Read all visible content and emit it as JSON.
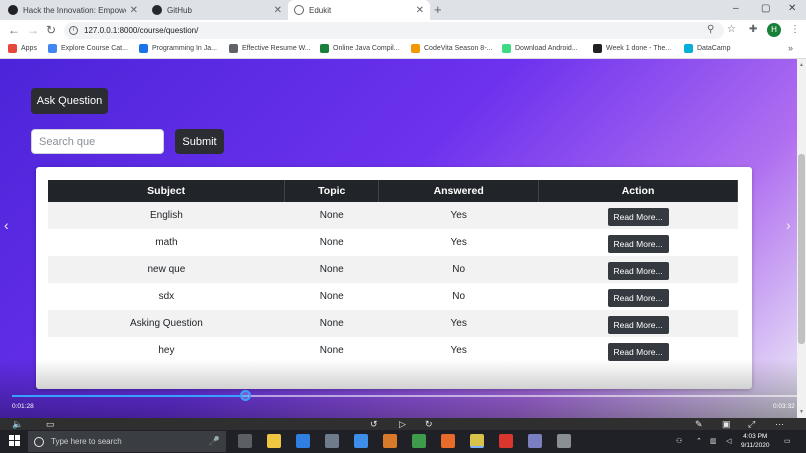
{
  "browser": {
    "tabs": [
      {
        "title": "Hack the Innovation: Empowerin",
        "active": false
      },
      {
        "title": "GitHub",
        "active": false
      },
      {
        "title": "Edukit",
        "active": true
      }
    ],
    "new_tab": "+",
    "window_controls": {
      "minimize": "–",
      "maximize": "▢",
      "close": "✕"
    },
    "url": "127.0.0.1:8000/course/question/",
    "bookmarks": [
      {
        "label": "Apps",
        "color": "#e8453c"
      },
      {
        "label": "Explore Course Cat...",
        "color": "#4285f4"
      },
      {
        "label": "Programming In Ja...",
        "color": "#1a73e8"
      },
      {
        "label": "Effective Resume W...",
        "color": "#5f6368"
      },
      {
        "label": "Online Java Compil...",
        "color": "#188038"
      },
      {
        "label": "CodeVita Season 8-...",
        "color": "#f29900"
      },
      {
        "label": "Download Android...",
        "color": "#3ddc84"
      },
      {
        "label": "Week 1 done - The...",
        "color": "#202124"
      },
      {
        "label": "DataCamp",
        "color": "#03b0d7"
      }
    ],
    "profile_initial": "H"
  },
  "page": {
    "ask_button": "Ask Question",
    "search_placeholder": "Search que",
    "submit_button": "Submit",
    "table": {
      "headers": [
        "Subject",
        "Topic",
        "Answered",
        "Action"
      ],
      "rows": [
        {
          "subject": "English",
          "topic": "None",
          "answered": "Yes",
          "action": "Read More..."
        },
        {
          "subject": "math",
          "topic": "None",
          "answered": "Yes",
          "action": "Read More..."
        },
        {
          "subject": "new que",
          "topic": "None",
          "answered": "No",
          "action": "Read More..."
        },
        {
          "subject": "sdx",
          "topic": "None",
          "answered": "No",
          "action": "Read More..."
        },
        {
          "subject": "Asking Question",
          "topic": "None",
          "answered": "Yes",
          "action": "Read More..."
        },
        {
          "subject": "hey",
          "topic": "None",
          "answered": "Yes",
          "action": "Read More..."
        }
      ]
    }
  },
  "video": {
    "elapsed": "0:01:28",
    "duration": "0:03:32",
    "progress_fraction": 0.3
  },
  "taskbar": {
    "search_placeholder": "Type here to search",
    "time": "4:03 PM",
    "date": "9/11/2020",
    "apps": [
      {
        "name": "task-view",
        "color": "#5c5f66"
      },
      {
        "name": "file-explorer",
        "color": "#f0c541"
      },
      {
        "name": "edge",
        "color": "#2f7fe0"
      },
      {
        "name": "store",
        "color": "#6e7b8a"
      },
      {
        "name": "mail",
        "color": "#3c8ee8"
      },
      {
        "name": "app-orange",
        "color": "#d97a2b"
      },
      {
        "name": "app-green",
        "color": "#3e9b4b"
      },
      {
        "name": "firefox",
        "color": "#e76b2b"
      },
      {
        "name": "chrome",
        "color": "#d8c24a"
      },
      {
        "name": "acrobat",
        "color": "#d9372d"
      },
      {
        "name": "app-stripe",
        "color": "#7a7fc2"
      },
      {
        "name": "app-circle",
        "color": "#8a8f96"
      }
    ]
  }
}
